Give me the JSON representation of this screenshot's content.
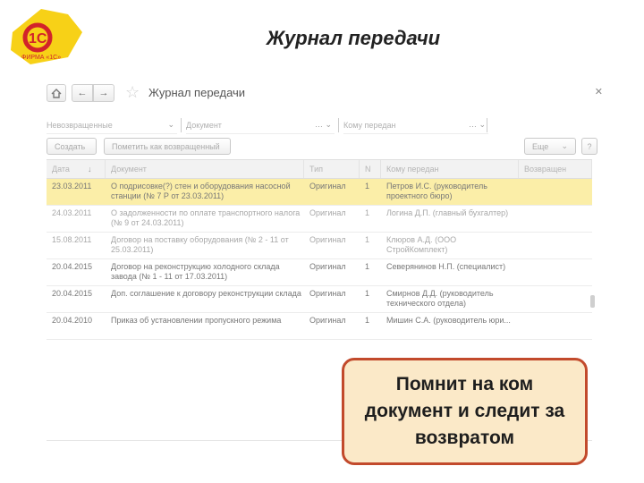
{
  "slide": {
    "title": "Журнал передачи",
    "logo_text": "1С",
    "logo_subtext": "ФИРМА «1С»"
  },
  "app": {
    "window_title": "Журнал передачи",
    "filters": [
      {
        "label": "Невозвращенные",
        "has_dropdown": true
      },
      {
        "label": "Документ",
        "has_dropdown": true
      },
      {
        "label": "Кому передан",
        "has_dropdown": true
      }
    ],
    "buttons": {
      "create": "Создать",
      "mark": "Пометить как возвращенный",
      "more": "Еще",
      "help": "?"
    },
    "columns": [
      "Дата",
      "Документ",
      "Тип",
      "N",
      "Кому передан",
      "Возвращен"
    ],
    "rows": [
      {
        "date": "23.03.2011",
        "doc": "О подрисовке(?) стен и оборудования насосной станции (№ 7 Р от 23.03.2011)",
        "type": "Оригинал",
        "n": "1",
        "who": "Петров И.С. (руководитель проектного бюро)",
        "ret": "",
        "selected": true
      },
      {
        "date": "24.03.2011",
        "doc": "О задолженности по оплате транспортного налога (№ 9 от 24.03.2011)",
        "type": "Оригинал",
        "n": "1",
        "who": "Логина Д.П. (главный бухгалтер)",
        "ret": "",
        "selected": false
      },
      {
        "date": "15.08.2011",
        "doc": "Договор на поставку оборудования (№ 2 - 11 от 25.03.2011)",
        "type": "Оригинал",
        "n": "1",
        "who": "Клюров А.Д. (ООО СтройКомплект)",
        "ret": "",
        "selected": false
      },
      {
        "date": "20.04.2015",
        "doc": "Договор на реконструкцию холодного склада завода (№ 1 - 11 от 17.03.2011)",
        "type": "Оригинал",
        "n": "1",
        "who": "Северянинов Н.П. (специалист)",
        "ret": "",
        "selected": false
      },
      {
        "date": "20.04.2015",
        "doc": "Доп. соглашение к договору реконструкции склада",
        "type": "Оригинал",
        "n": "1",
        "who": "Смирнов Д.Д. (руководитель технического отдела)",
        "ret": "",
        "selected": false
      },
      {
        "date": "20.04.2010",
        "doc": "Приказ об установлении пропускного режима",
        "type": "Оригинал",
        "n": "1",
        "who": "Мишин С.А. (руководитель юри...",
        "ret": "",
        "selected": false
      }
    ]
  },
  "callout": {
    "text": "Помнит на ком документ и следит за возвратом"
  },
  "colors": {
    "selected_row": "#fbeea8",
    "callout_bg": "#fbe9c8",
    "callout_border": "#c24a2c",
    "logo_yellow": "#f7d117",
    "logo_red": "#d2232a"
  }
}
